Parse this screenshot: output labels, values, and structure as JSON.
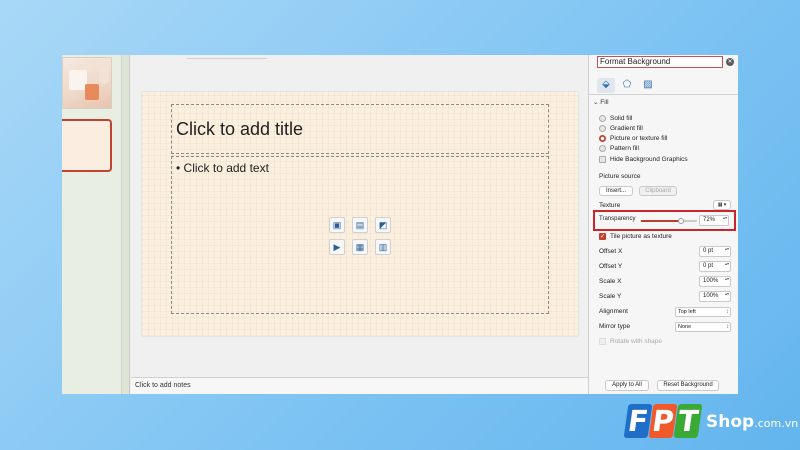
{
  "slide": {
    "title_placeholder": "Click to add title",
    "body_placeholder": "• Click to add text",
    "notes_placeholder": "Click to add notes",
    "insert_icons": [
      "insert-picture-icon",
      "insert-stock-image-icon",
      "insert-icon-icon",
      "insert-video-icon",
      "insert-table-icon",
      "insert-smartart-icon"
    ]
  },
  "pane": {
    "title": "Format Background",
    "close_icon": "close-icon",
    "tabs": [
      "fill-bucket-icon",
      "effects-pentagon-icon",
      "picture-icon"
    ],
    "section_fill": "Fill",
    "fill_options": [
      {
        "label": "Solid fill",
        "selected": false
      },
      {
        "label": "Gradient fill",
        "selected": false
      },
      {
        "label": "Picture or texture fill",
        "selected": true
      },
      {
        "label": "Pattern fill",
        "selected": false
      }
    ],
    "hide_graphics": "Hide Background Graphics",
    "picture_source": "Picture source",
    "insert_button": "Insert...",
    "clipboard_button": "Clipboard",
    "texture_label": "Texture",
    "transparency_label": "Transparency",
    "transparency_value": "72%",
    "transparency_level": 72,
    "tile_label": "Tile picture as texture",
    "offset_x_label": "Offset X",
    "offset_x_value": "0 pt",
    "offset_y_label": "Offset Y",
    "offset_y_value": "0 pt",
    "scale_x_label": "Scale X",
    "scale_x_value": "100%",
    "scale_y_label": "Scale Y",
    "scale_y_value": "100%",
    "alignment_label": "Alignment",
    "alignment_value": "Top left",
    "mirror_label": "Mirror type",
    "mirror_value": "None",
    "rotate_label": "Rotate with shape",
    "apply_all_button": "Apply to All",
    "reset_button": "Reset Background"
  },
  "logo": {
    "letters": [
      "F",
      "P",
      "T"
    ],
    "shop": "Shop",
    "domain": ".com.vn",
    "colors": {
      "f": "#1f6fc9",
      "p": "#f1592a",
      "t": "#3aa935"
    }
  },
  "colors": {
    "accent": "#c1412e",
    "highlight": "#c9252b"
  }
}
